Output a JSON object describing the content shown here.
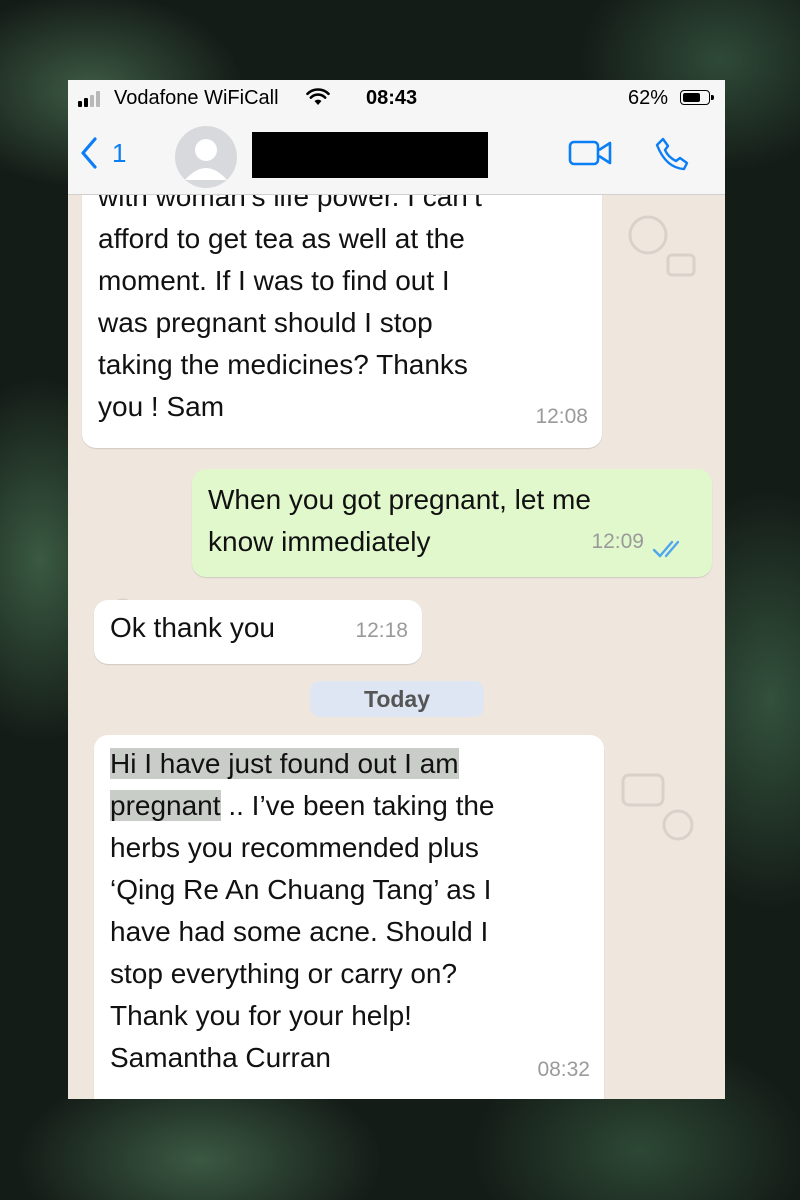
{
  "status_bar": {
    "carrier": "Vodafone WiFiCall",
    "time": "08:43",
    "battery": "62%"
  },
  "header": {
    "back_count": "1"
  },
  "messages": [
    {
      "direction": "incoming",
      "text": "with woman's life power. I can't afford to get tea as well at the moment. If I was to find out I was pregnant should I stop taking the medicines? Thanks you ! Sam",
      "lines": [
        "with woman’s life power. I can’t",
        "afford to get tea as well at the",
        "moment. If I was to find out I",
        "was pregnant should I stop",
        "taking the medicines? Thanks",
        "you ! Sam"
      ],
      "time": "12:08"
    },
    {
      "direction": "outgoing",
      "lines": [
        "When you got pregnant, let me",
        "know immediately"
      ],
      "time": "12:09",
      "status": "read"
    },
    {
      "direction": "incoming",
      "lines": [
        "Ok thank you"
      ],
      "time": "12:18"
    },
    {
      "direction": "incoming",
      "highlighted": [
        "Hi I have just found out I am",
        "pregnant"
      ],
      "lines": [
        " .. I’ve been taking the",
        "herbs you recommended plus",
        "‘Qing Re An Chuang Tang’ as I",
        "have had some acne. Should I",
        "stop everything or carry on?",
        "Thank you for your help!",
        "Samantha Curran"
      ],
      "time": "08:32"
    }
  ],
  "date_divider": "Today",
  "colors": {
    "incoming_bubble": "#ffffff",
    "outgoing_bubble": "#e1f8cc",
    "chat_background": "#efe7de",
    "accent_blue": "#0b7ef6",
    "read_ticks": "#4fa6f0"
  },
  "icons": [
    "signal-icon",
    "wifi-icon",
    "battery-icon",
    "chevron-left-icon",
    "avatar-icon",
    "video-call-icon",
    "phone-call-icon",
    "double-check-icon"
  ]
}
